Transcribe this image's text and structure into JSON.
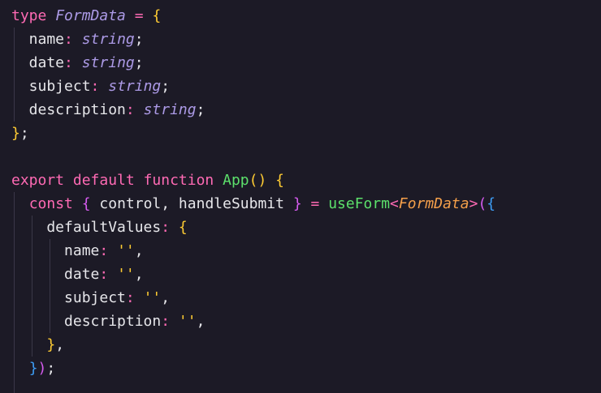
{
  "editor": {
    "lines": [
      {
        "tokens": [
          {
            "t": "type",
            "c": "kw"
          },
          {
            "t": " ",
            "c": "pu"
          },
          {
            "t": "FormData",
            "c": "ty"
          },
          {
            "t": " ",
            "c": "pu"
          },
          {
            "t": "=",
            "c": "op"
          },
          {
            "t": " ",
            "c": "pu"
          },
          {
            "t": "{",
            "c": "br1"
          }
        ]
      },
      {
        "tokens": [
          {
            "t": "  name",
            "c": "pr"
          },
          {
            "t": ":",
            "c": "op"
          },
          {
            "t": " ",
            "c": "pu"
          },
          {
            "t": "string",
            "c": "ts"
          },
          {
            "t": ";",
            "c": "pu"
          }
        ]
      },
      {
        "tokens": [
          {
            "t": "  date",
            "c": "pr"
          },
          {
            "t": ":",
            "c": "op"
          },
          {
            "t": " ",
            "c": "pu"
          },
          {
            "t": "string",
            "c": "ts"
          },
          {
            "t": ";",
            "c": "pu"
          }
        ]
      },
      {
        "tokens": [
          {
            "t": "  subject",
            "c": "pr"
          },
          {
            "t": ":",
            "c": "op"
          },
          {
            "t": " ",
            "c": "pu"
          },
          {
            "t": "string",
            "c": "ts"
          },
          {
            "t": ";",
            "c": "pu"
          }
        ]
      },
      {
        "tokens": [
          {
            "t": "  description",
            "c": "pr"
          },
          {
            "t": ":",
            "c": "op"
          },
          {
            "t": " ",
            "c": "pu"
          },
          {
            "t": "string",
            "c": "ts"
          },
          {
            "t": ";",
            "c": "pu"
          }
        ]
      },
      {
        "tokens": [
          {
            "t": "}",
            "c": "br1"
          },
          {
            "t": ";",
            "c": "pu"
          }
        ]
      },
      {
        "tokens": []
      },
      {
        "tokens": [
          {
            "t": "export",
            "c": "kw"
          },
          {
            "t": " ",
            "c": "pu"
          },
          {
            "t": "default",
            "c": "kw"
          },
          {
            "t": " ",
            "c": "pu"
          },
          {
            "t": "function",
            "c": "kw"
          },
          {
            "t": " ",
            "c": "pu"
          },
          {
            "t": "App",
            "c": "fn"
          },
          {
            "t": "()",
            "c": "br1"
          },
          {
            "t": " ",
            "c": "pu"
          },
          {
            "t": "{",
            "c": "br1"
          }
        ]
      },
      {
        "tokens": [
          {
            "t": "  ",
            "c": "pu"
          },
          {
            "t": "const",
            "c": "kw"
          },
          {
            "t": " ",
            "c": "pu"
          },
          {
            "t": "{",
            "c": "br2"
          },
          {
            "t": " control, handleSubmit ",
            "c": "pr"
          },
          {
            "t": "}",
            "c": "br2"
          },
          {
            "t": " ",
            "c": "pu"
          },
          {
            "t": "=",
            "c": "op"
          },
          {
            "t": " ",
            "c": "pu"
          },
          {
            "t": "useForm",
            "c": "fn"
          },
          {
            "t": "<",
            "c": "op"
          },
          {
            "t": "FormData",
            "c": "gn"
          },
          {
            "t": ">",
            "c": "op"
          },
          {
            "t": "(",
            "c": "br2"
          },
          {
            "t": "{",
            "c": "br3"
          }
        ]
      },
      {
        "tokens": [
          {
            "t": "    defaultValues",
            "c": "pr"
          },
          {
            "t": ":",
            "c": "op"
          },
          {
            "t": " ",
            "c": "pu"
          },
          {
            "t": "{",
            "c": "br1"
          }
        ]
      },
      {
        "tokens": [
          {
            "t": "      name",
            "c": "pr"
          },
          {
            "t": ":",
            "c": "op"
          },
          {
            "t": " ",
            "c": "pu"
          },
          {
            "t": "''",
            "c": "st"
          },
          {
            "t": ",",
            "c": "pu"
          }
        ]
      },
      {
        "tokens": [
          {
            "t": "      date",
            "c": "pr"
          },
          {
            "t": ":",
            "c": "op"
          },
          {
            "t": " ",
            "c": "pu"
          },
          {
            "t": "''",
            "c": "st"
          },
          {
            "t": ",",
            "c": "pu"
          }
        ]
      },
      {
        "tokens": [
          {
            "t": "      subject",
            "c": "pr"
          },
          {
            "t": ":",
            "c": "op"
          },
          {
            "t": " ",
            "c": "pu"
          },
          {
            "t": "''",
            "c": "st"
          },
          {
            "t": ",",
            "c": "pu"
          }
        ]
      },
      {
        "tokens": [
          {
            "t": "      description",
            "c": "pr"
          },
          {
            "t": ":",
            "c": "op"
          },
          {
            "t": " ",
            "c": "pu"
          },
          {
            "t": "''",
            "c": "st"
          },
          {
            "t": ",",
            "c": "pu"
          }
        ]
      },
      {
        "tokens": [
          {
            "t": "    ",
            "c": "pu"
          },
          {
            "t": "}",
            "c": "br1"
          },
          {
            "t": ",",
            "c": "pu"
          }
        ]
      },
      {
        "tokens": [
          {
            "t": "  ",
            "c": "pu"
          },
          {
            "t": "}",
            "c": "br3"
          },
          {
            "t": ")",
            "c": "br2"
          },
          {
            "t": ";",
            "c": "pu"
          }
        ]
      }
    ]
  }
}
